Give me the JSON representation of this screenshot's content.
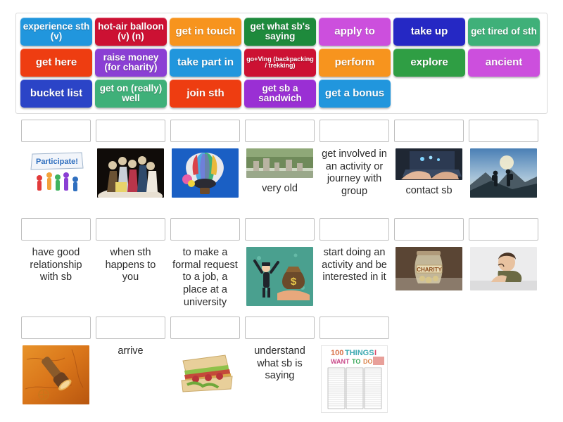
{
  "activity": {
    "type": "match-up-drag-drop",
    "colors": {
      "tile_blue": "#2196dd",
      "tile_crimson": "#cc1133",
      "tile_orange": "#f7941e",
      "tile_green_dark": "#1e8a3c",
      "tile_orchid": "#cc4fdd",
      "tile_navy": "#2528c4",
      "tile_seagreen": "#3fb079",
      "tile_orangered": "#ee3d11",
      "tile_purple": "#8b3fd4",
      "tile_skyblue": "#2196dd",
      "tile_royal": "#2b44c7",
      "dropzone_border": "#bfbfbf",
      "bank_border": "#d9d9d9",
      "text": "#2b2b2b"
    }
  },
  "tile_bank": {
    "name": "draggable-word-tiles",
    "rows": [
      [
        {
          "label": "experience sth (v)",
          "color": "#2196dd",
          "size": "s16"
        },
        {
          "label": "hot-air balloon (v) (n)",
          "color": "#cc1133",
          "size": "s16"
        },
        {
          "label": "get in touch",
          "color": "#f7941e",
          "size": "s18"
        },
        {
          "label": "get what sb's saying",
          "color": "#1e8a3c",
          "size": "s16"
        },
        {
          "label": "apply to",
          "color": "#cc4fdd",
          "size": "s18"
        },
        {
          "label": "take up",
          "color": "#2528c4",
          "size": "s18"
        },
        {
          "label": "get tired of sth",
          "color": "#3fb079",
          "size": "s16"
        }
      ],
      [
        {
          "label": "get here",
          "color": "#ee3d11",
          "size": "s18"
        },
        {
          "label": "raise money (for charity)",
          "color": "#8b3fd4",
          "size": "s16"
        },
        {
          "label": "take part in",
          "color": "#2196dd",
          "size": "s18"
        },
        {
          "label": "go+Ving (backpacking / trekking)",
          "color": "#cc1133",
          "size": "s10"
        },
        {
          "label": "perform",
          "color": "#f7941e",
          "size": "s18"
        },
        {
          "label": "explore",
          "color": "#2f9e44",
          "size": "s18"
        },
        {
          "label": "ancient",
          "color": "#cc4fdd",
          "size": "s18"
        }
      ],
      [
        {
          "label": "bucket list",
          "color": "#2b44c7",
          "size": "s18"
        },
        {
          "label": "get on (really) well",
          "color": "#3fb079",
          "size": "s16"
        },
        {
          "label": "join sth",
          "color": "#ee3d11",
          "size": "s18"
        },
        {
          "label": "get sb a sandwich",
          "color": "#9a2fd4",
          "size": "s16"
        },
        {
          "label": "get a bonus",
          "color": "#2196dd",
          "size": "s18"
        }
      ]
    ]
  },
  "answer_rows": [
    {
      "name": "answer-row-1",
      "cells": [
        {
          "kind": "image",
          "image": "participate-people-banner",
          "caption": ""
        },
        {
          "kind": "image",
          "image": "theatre-performance-actors",
          "caption": ""
        },
        {
          "kind": "image",
          "image": "hot-air-balloon-sky",
          "caption": ""
        },
        {
          "kind": "image",
          "image": "ancient-ruins-landscape",
          "caption": "very old"
        },
        {
          "kind": "text",
          "text": "get involved in an activity or journey with group"
        },
        {
          "kind": "image",
          "image": "hands-typing-laptop",
          "caption": "contact sb"
        },
        {
          "kind": "image",
          "image": "hikers-backpacking-mountain",
          "caption": ""
        }
      ]
    },
    {
      "name": "answer-row-2",
      "cells": [
        {
          "kind": "text",
          "text": "have good relationship with sb"
        },
        {
          "kind": "text",
          "text": "when sth happens to you"
        },
        {
          "kind": "text",
          "text": "to make a formal request to a job, a place at a university"
        },
        {
          "kind": "image",
          "image": "man-celebrating-money-bag",
          "caption": ""
        },
        {
          "kind": "text",
          "text": "start doing an activity and be interested in it"
        },
        {
          "kind": "image",
          "image": "charity-coin-jar",
          "caption": ""
        },
        {
          "kind": "image",
          "image": "tired-bored-woman",
          "caption": ""
        }
      ]
    },
    {
      "name": "answer-row-3",
      "cells": [
        {
          "kind": "image",
          "image": "spyglass-old-map",
          "caption": ""
        },
        {
          "kind": "text",
          "text": "arrive"
        },
        {
          "kind": "image",
          "image": "club-sandwich",
          "caption": ""
        },
        {
          "kind": "text",
          "text": "understand what sb is saying"
        },
        {
          "kind": "image",
          "image": "100-things-to-do-list",
          "caption": ""
        }
      ]
    }
  ]
}
